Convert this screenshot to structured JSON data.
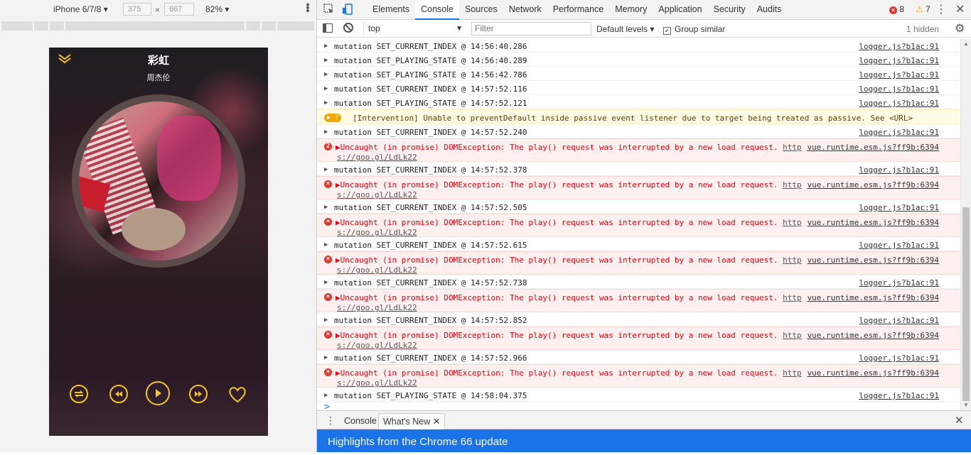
{
  "device": {
    "name": "iPhone 6/7/8",
    "width": "375",
    "height": "667",
    "zoom": "82%",
    "times": "×"
  },
  "player": {
    "title": "彩虹",
    "artist": "周杰伦",
    "controls": [
      "repeat",
      "prev",
      "play",
      "next",
      "favorite"
    ]
  },
  "devtools": {
    "tabs": [
      "Elements",
      "Console",
      "Sources",
      "Network",
      "Performance",
      "Memory",
      "Application",
      "Security",
      "Audits"
    ],
    "active_tab": "Console",
    "error_count": "8",
    "warning_count": "7",
    "context": "top",
    "filter_placeholder": "Filter",
    "levels": "Default levels",
    "group_similar": "Group similar",
    "hidden": "1 hidden"
  },
  "console": {
    "rows": [
      {
        "type": "log",
        "text": "mutation SET_CURRENT_INDEX @ 14:56:40.286",
        "src": "logger.js?b1ac:91"
      },
      {
        "type": "log",
        "text": "mutation SET_PLAYING_STATE @ 14:56:40.289",
        "src": "logger.js?b1ac:91"
      },
      {
        "type": "log",
        "text": "mutation SET_PLAYING_STATE @ 14:56:42.786",
        "src": "logger.js?b1ac:91"
      },
      {
        "type": "log",
        "text": "mutation SET_CURRENT_INDEX @ 14:57:52.116",
        "src": "logger.js?b1ac:91"
      },
      {
        "type": "log",
        "text": "mutation SET_PLAYING_STATE @ 14:57:52.121",
        "src": "logger.js?b1ac:91"
      },
      {
        "type": "warn",
        "badge": "7",
        "text": "[Intervention] Unable to preventDefault inside passive event listener due to target being treated as passive. See <URL>"
      },
      {
        "type": "log",
        "text": "mutation SET_CURRENT_INDEX @ 14:57:52.240",
        "src": "logger.js?b1ac:91"
      },
      {
        "type": "error",
        "badge": "2",
        "text": "Uncaught (in promise) DOMException: The play() request was interrupted by a new load request.",
        "link1": "http",
        "link2": "s://goo.gl/LdLk22",
        "src": "vue.runtime.esm.js?ff9b:6394"
      },
      {
        "type": "log",
        "text": "mutation SET_CURRENT_INDEX @ 14:57:52.378",
        "src": "logger.js?b1ac:91"
      },
      {
        "type": "error",
        "badge": "×",
        "text": "Uncaught (in promise) DOMException: The play() request was interrupted by a new load request.",
        "link1": "http",
        "link2": "s://goo.gl/LdLk22",
        "src": "vue.runtime.esm.js?ff9b:6394"
      },
      {
        "type": "log",
        "text": "mutation SET_CURRENT_INDEX @ 14:57:52.505",
        "src": "logger.js?b1ac:91"
      },
      {
        "type": "error",
        "badge": "×",
        "text": "Uncaught (in promise) DOMException: The play() request was interrupted by a new load request.",
        "link1": "http",
        "link2": "s://goo.gl/LdLk22",
        "src": "vue.runtime.esm.js?ff9b:6394"
      },
      {
        "type": "log",
        "text": "mutation SET_CURRENT_INDEX @ 14:57:52.615",
        "src": "logger.js?b1ac:91"
      },
      {
        "type": "error",
        "badge": "×",
        "text": "Uncaught (in promise) DOMException: The play() request was interrupted by a new load request.",
        "link1": "http",
        "link2": "s://goo.gl/LdLk22",
        "src": "vue.runtime.esm.js?ff9b:6394"
      },
      {
        "type": "log",
        "text": "mutation SET_CURRENT_INDEX @ 14:57:52.738",
        "src": "logger.js?b1ac:91"
      },
      {
        "type": "error",
        "badge": "×",
        "text": "Uncaught (in promise) DOMException: The play() request was interrupted by a new load request.",
        "link1": "http",
        "link2": "s://goo.gl/LdLk22",
        "src": "vue.runtime.esm.js?ff9b:6394"
      },
      {
        "type": "log",
        "text": "mutation SET_CURRENT_INDEX @ 14:57:52.852",
        "src": "logger.js?b1ac:91"
      },
      {
        "type": "error",
        "badge": "×",
        "text": "Uncaught (in promise) DOMException: The play() request was interrupted by a new load request.",
        "link1": "http",
        "link2": "s://goo.gl/LdLk22",
        "src": "vue.runtime.esm.js?ff9b:6394"
      },
      {
        "type": "log",
        "text": "mutation SET_CURRENT_INDEX @ 14:57:52.966",
        "src": "logger.js?b1ac:91"
      },
      {
        "type": "error",
        "badge": "×",
        "text": "Uncaught (in promise) DOMException: The play() request was interrupted by a new load request.",
        "link1": "http",
        "link2": "s://goo.gl/LdLk22",
        "src": "vue.runtime.esm.js?ff9b:6394"
      },
      {
        "type": "log",
        "text": "mutation SET_PLAYING_STATE @ 14:58:04.375",
        "src": "logger.js?b1ac:91"
      }
    ],
    "prompt": ">"
  },
  "drawer": {
    "tabs": [
      "Console",
      "What's New"
    ],
    "active": "What's New",
    "close": "×"
  },
  "banner": {
    "text": "Highlights from the Chrome 66 update"
  },
  "colors": {
    "accent": "#1a73e8",
    "player_icon": "#f5c518",
    "error": "#e2372e",
    "warning": "#f2a600"
  }
}
